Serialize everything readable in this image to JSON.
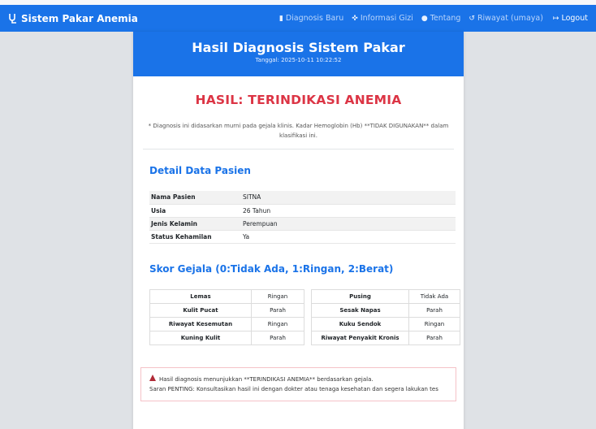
{
  "navbar": {
    "brand": "Sistem Pakar Anemia",
    "links": [
      {
        "label": "Diagnosis Baru",
        "icon": "file-icon"
      },
      {
        "label": "Informasi Gizi",
        "icon": "utensils-icon"
      },
      {
        "label": "Tentang",
        "icon": "info-icon"
      },
      {
        "label": "Riwayat (umaya)",
        "icon": "history-icon"
      }
    ],
    "logout": "Logout"
  },
  "header": {
    "title": "Hasil Diagnosis Sistem Pakar",
    "date": "Tanggal: 2025-10-11 10:22:52"
  },
  "result": {
    "title": "HASIL: TERINDIKASI ANEMIA",
    "note": "* Diagnosis ini didasarkan murni pada gejala klinis. Kadar Hemoglobin (Hb) **TIDAK DIGUNAKAN** dalam klasifikasi ini."
  },
  "patient": {
    "heading": "Detail Data Pasien",
    "rows": [
      {
        "label": "Nama Pasien",
        "value": "SITNA"
      },
      {
        "label": "Usia",
        "value": "26 Tahun"
      },
      {
        "label": "Jenis Kelamin",
        "value": "Perempuan"
      },
      {
        "label": "Status Kehamilan",
        "value": "Ya"
      }
    ]
  },
  "symptoms": {
    "heading": "Skor Gejala (0:Tidak Ada, 1:Ringan, 2:Berat)",
    "left": [
      {
        "name": "Lemas",
        "value": "Ringan"
      },
      {
        "name": "Kulit Pucat",
        "value": "Parah"
      },
      {
        "name": "Riwayat Kesemutan",
        "value": "Ringan"
      },
      {
        "name": "Kuning Kulit",
        "value": "Parah"
      }
    ],
    "right": [
      {
        "name": "Pusing",
        "value": "Tidak Ada"
      },
      {
        "name": "Sesak Napas",
        "value": "Parah"
      },
      {
        "name": "Kuku Sendok",
        "value": "Ringan"
      },
      {
        "name": "Riwayat Penyakit Kronis",
        "value": "Parah"
      }
    ]
  },
  "alert": {
    "line1": "Hasil diagnosis menunjukkan **TERINDIKASI ANEMIA** berdasarkan gejala.",
    "line2": "Saran PENTING: Konsultasikan hasil ini dengan dokter atau tenaga kesehatan dan segera lakukan tes"
  },
  "colors": {
    "primary": "#1a73e8",
    "danger": "#dc3545"
  }
}
